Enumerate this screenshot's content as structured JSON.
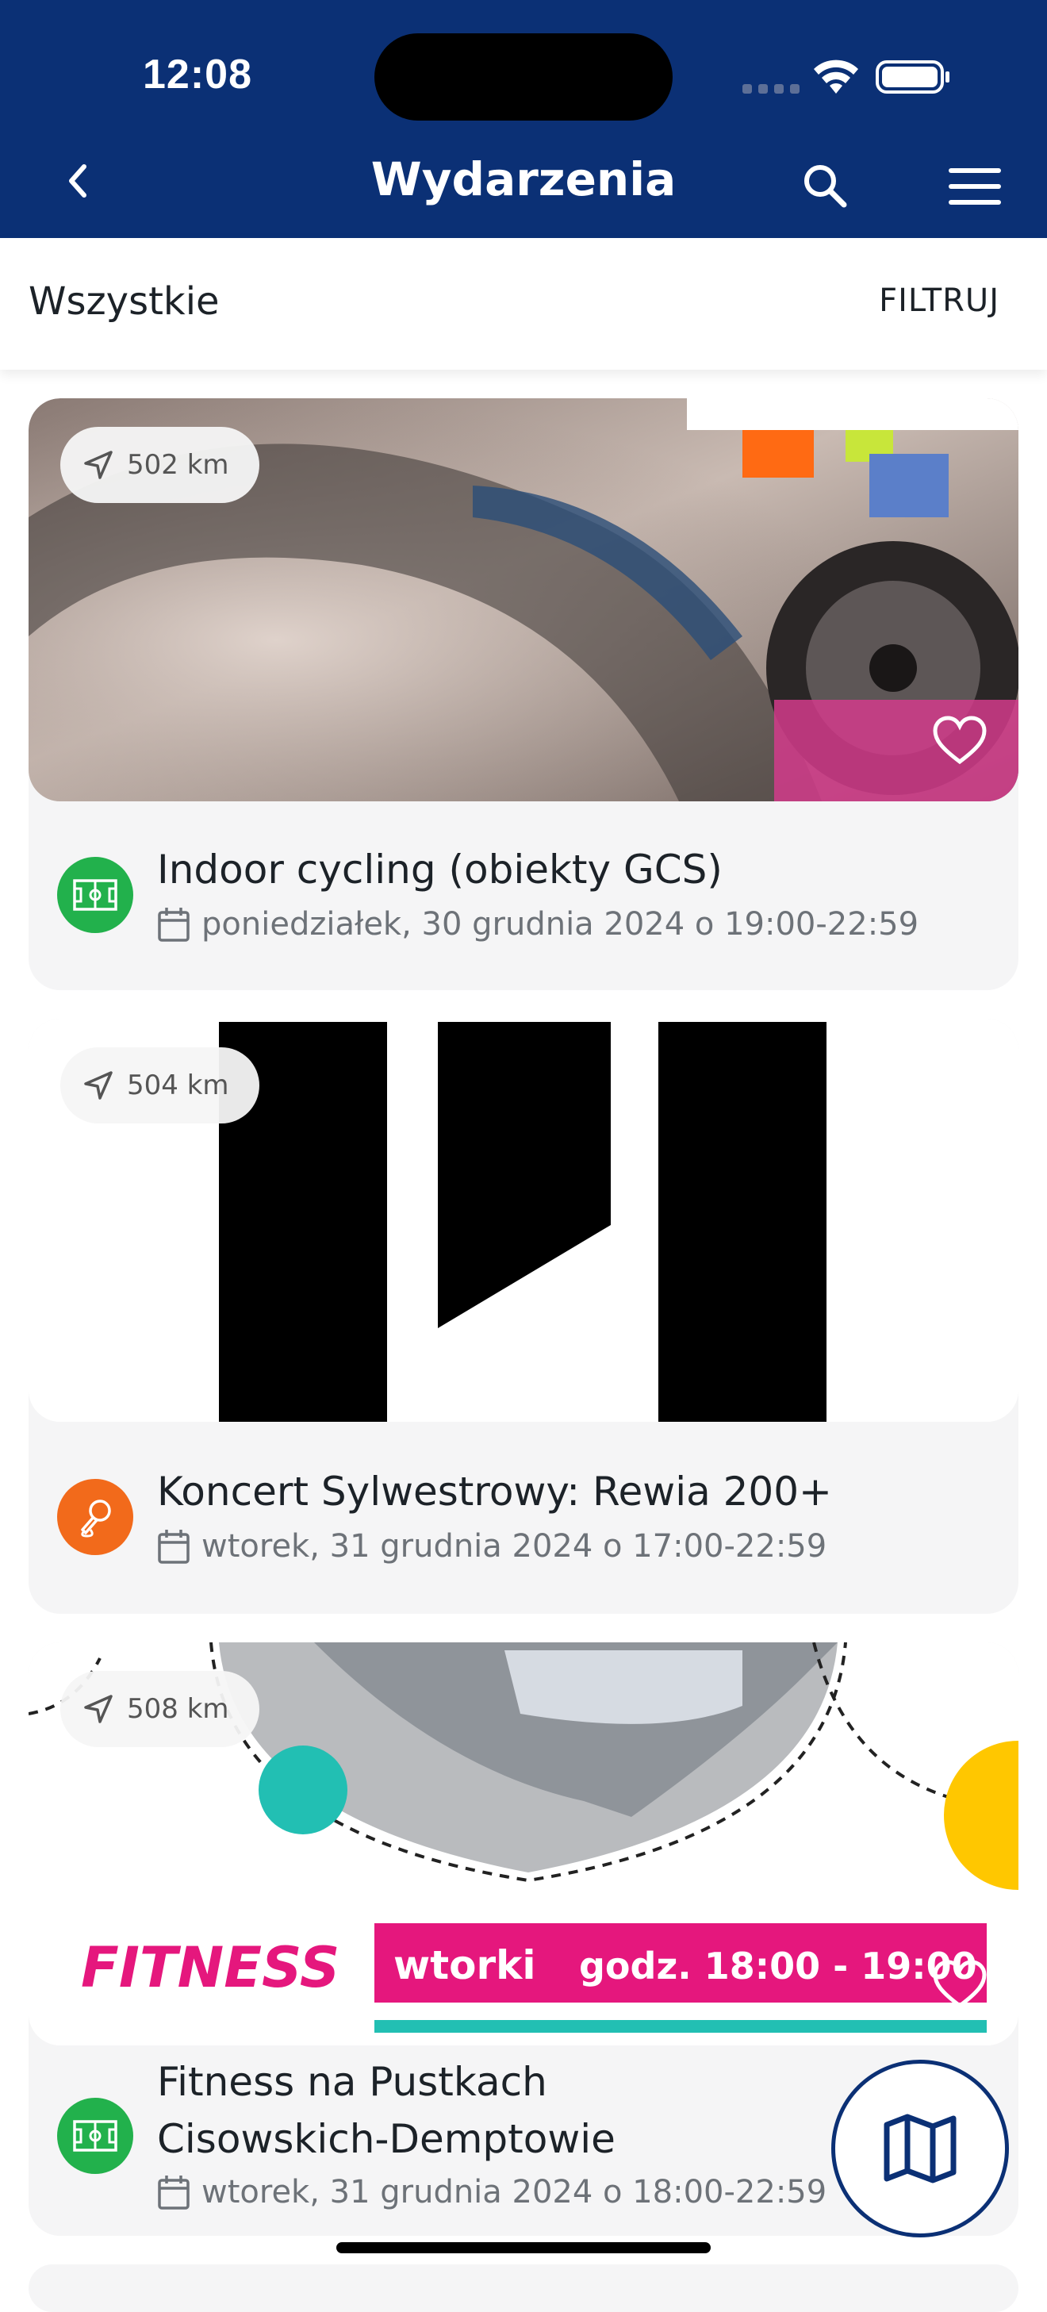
{
  "status": {
    "time": "12:08"
  },
  "header": {
    "title": "Wydarzenia"
  },
  "filterbar": {
    "label": "Wszystkie",
    "filter_button": "FILTRUJ"
  },
  "events": [
    {
      "distance": "502 km",
      "title": "Indoor cycling (obiekty GCS)",
      "date": "poniedziałek, 30 grudnia 2024 o 19:00-22:59",
      "category_icon": "sports-field-icon",
      "category_color": "#22b14c"
    },
    {
      "distance": "504 km",
      "title": "Koncert Sylwestrowy: Rewia 200+",
      "date": "wtorek, 31 grudnia 2024 o 17:00-22:59",
      "category_icon": "microphone-icon",
      "category_color": "#f26a1b"
    },
    {
      "distance": "508 km",
      "title_line1": "Fitness na Pustkach",
      "title_line2": "Cisowskich-Demptowie",
      "date": "wtorek, 31 grudnia 2024 o 18:00-22:59",
      "category_icon": "sports-field-icon",
      "category_color": "#22b14c",
      "banner": {
        "brand": "FITNESS",
        "day": "wtorki",
        "hours": "godz. 18:00 - 19:00"
      }
    }
  ],
  "colors": {
    "header_bg": "#0b3075",
    "card_bg": "#f5f5f6",
    "accent_pink": "#e5177d",
    "accent_teal": "#22bfb3",
    "accent_yellow": "#ffc700"
  }
}
